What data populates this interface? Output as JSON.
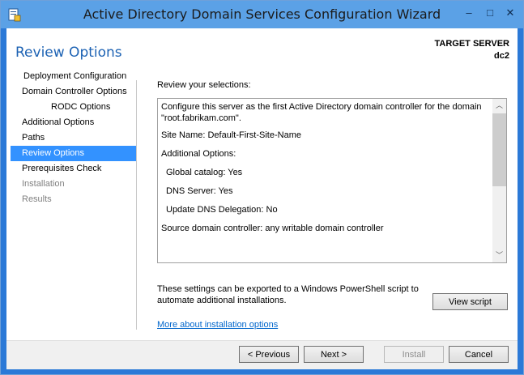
{
  "window": {
    "title": "Active Directory Domain Services Configuration Wizard"
  },
  "titlebar": {
    "minimize_glyph": "–",
    "maximize_glyph": "□",
    "close_glyph": "✕"
  },
  "page": {
    "title": "Review Options",
    "target_label": "TARGET SERVER",
    "target_name": "dc2"
  },
  "nav": {
    "items": [
      {
        "label": "Deployment Configuration",
        "state": "normal"
      },
      {
        "label": "Domain Controller Options",
        "state": "normal"
      },
      {
        "label": "RODC Options",
        "state": "normal"
      },
      {
        "label": "Additional Options",
        "state": "normal"
      },
      {
        "label": "Paths",
        "state": "normal"
      },
      {
        "label": "Review Options",
        "state": "selected"
      },
      {
        "label": "Prerequisites Check",
        "state": "normal"
      },
      {
        "label": "Installation",
        "state": "disabled"
      },
      {
        "label": "Results",
        "state": "disabled"
      }
    ]
  },
  "review": {
    "heading": "Review your selections:",
    "lines": [
      "Configure this server as the first Active Directory domain controller for the domain",
      "\"root.fabrikam.com\".",
      "Site Name: Default-First-Site-Name",
      "Additional Options:",
      "Global catalog: Yes",
      "DNS Server: Yes",
      "Update DNS Delegation: No",
      "Source domain controller: any writable domain controller"
    ]
  },
  "export": {
    "line1": "These settings can be exported to a Windows PowerShell script to",
    "line2": "automate additional installations.",
    "view_script": "View script"
  },
  "link": {
    "more_options": "More about installation options"
  },
  "footer": {
    "previous": "< Previous",
    "next": "Next >",
    "install": "Install",
    "cancel": "Cancel"
  },
  "colors": {
    "titlebar": "#5ba1e6",
    "accent": "#3392ff",
    "title_text": "#1e63b4",
    "link": "#0066cc"
  }
}
